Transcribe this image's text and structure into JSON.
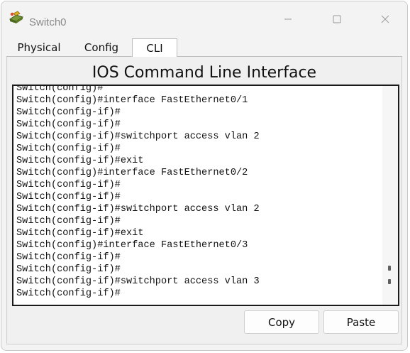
{
  "window": {
    "title": "Switch0",
    "app_icon": "packet-tracer-switch-icon",
    "controls": {
      "minimize": "minimize-icon",
      "maximize": "maximize-icon",
      "close": "close-icon"
    }
  },
  "tabs": [
    {
      "label": "Physical",
      "active": false
    },
    {
      "label": "Config",
      "active": false
    },
    {
      "label": "CLI",
      "active": true
    }
  ],
  "cli": {
    "heading": "IOS Command Line Interface",
    "lines": [
      "Switch(config)#",
      "Switch(config)#interface FastEthernet0/1",
      "Switch(config-if)#",
      "Switch(config-if)#",
      "Switch(config-if)#switchport access vlan 2",
      "Switch(config-if)#",
      "Switch(config-if)#exit",
      "Switch(config)#interface FastEthernet0/2",
      "Switch(config-if)#",
      "Switch(config-if)#",
      "Switch(config-if)#switchport access vlan 2",
      "Switch(config-if)#",
      "Switch(config-if)#exit",
      "Switch(config)#interface FastEthernet0/3",
      "Switch(config-if)#",
      "Switch(config-if)#",
      "Switch(config-if)#switchport access vlan 3",
      "Switch(config-if)#"
    ],
    "buttons": {
      "copy": "Copy",
      "paste": "Paste"
    }
  }
}
